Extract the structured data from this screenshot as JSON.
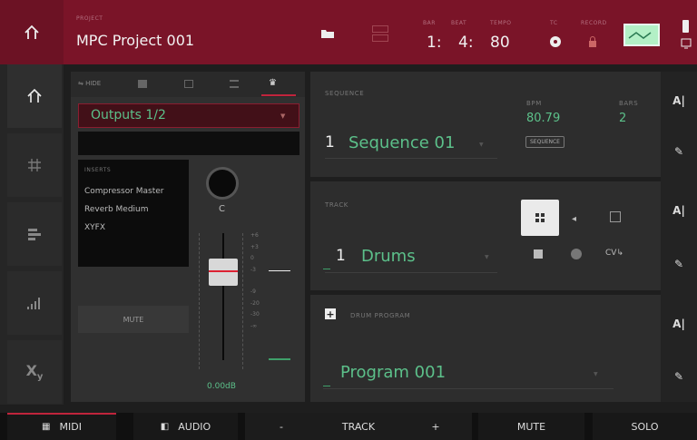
{
  "header": {
    "project_label": "PROJECT",
    "project_name": "MPC Project 001",
    "bar_label": "BAR",
    "beat_label": "BEAT",
    "tempo_label": "TEMPO",
    "bar": "1:",
    "beat": "4:",
    "tempo": "80",
    "tc_label": "TC",
    "record_label": "RECORD"
  },
  "mixer": {
    "hide_label": "HIDE",
    "output": "Outputs 1/2",
    "inserts_label": "INSERTS",
    "inserts": [
      "Compressor Master",
      "Reverb Medium",
      "XYFX"
    ],
    "pan_value": "C",
    "mute_label": "MUTE",
    "level": "0.00dB",
    "scale": [
      "+6",
      "+3",
      "0",
      "-3",
      "-9",
      "-20",
      "-30",
      "-∞"
    ]
  },
  "sequence": {
    "label": "SEQUENCE",
    "number": "1",
    "name": "Sequence 01",
    "bpm_label": "BPM",
    "bpm": "80.79",
    "bars_label": "BARS",
    "bars": "2",
    "tempo_source": "SEQUENCE"
  },
  "track": {
    "label": "TRACK",
    "number": "1",
    "name": "Drums",
    "cv_label": "CV"
  },
  "program": {
    "label": "DRUM PROGRAM",
    "name": "Program 001"
  },
  "bottom": {
    "midi": "MIDI",
    "audio": "AUDIO",
    "minus": "-",
    "track": "TRACK",
    "plus": "+",
    "mute": "MUTE",
    "solo": "SOLO"
  }
}
